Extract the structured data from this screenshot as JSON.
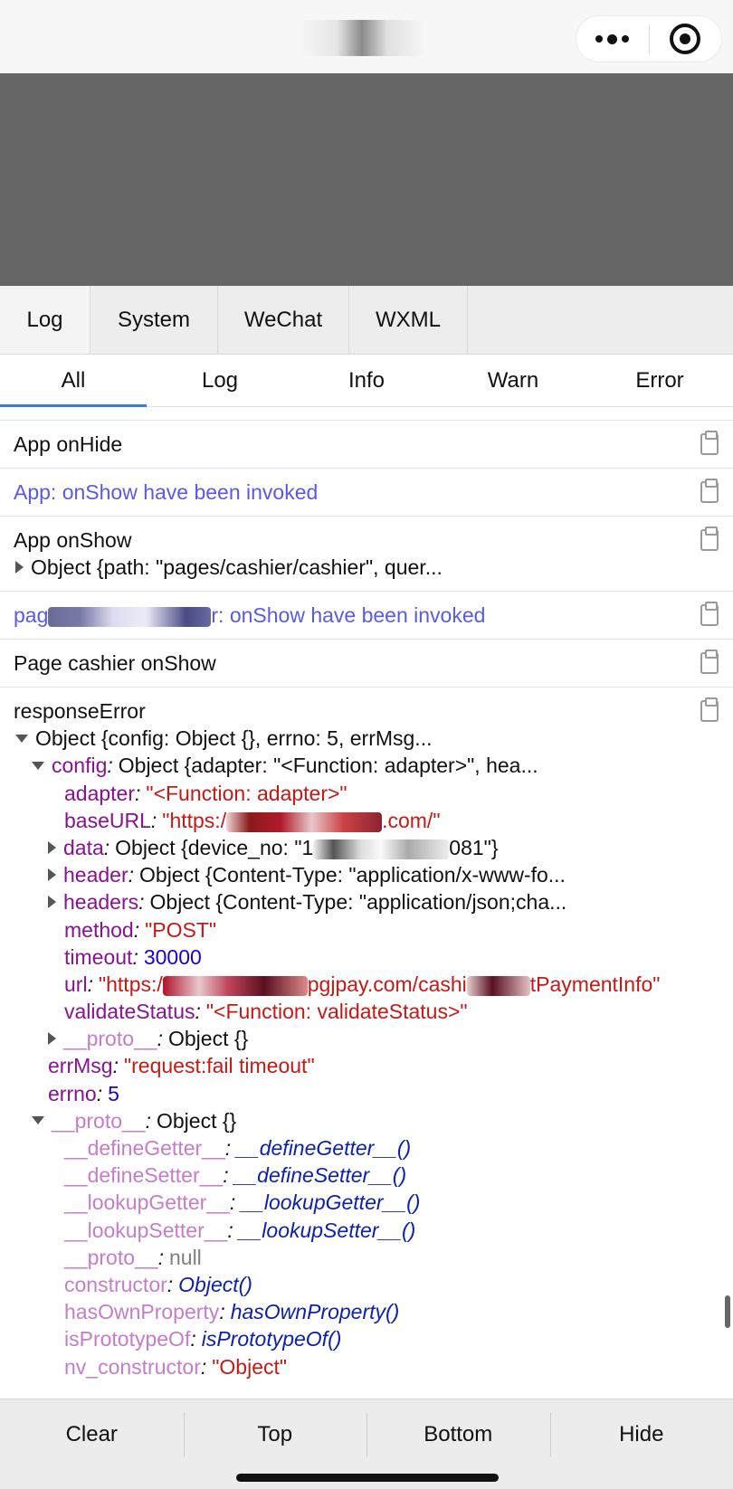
{
  "capsule": {
    "more_icon": "more-dots-icon",
    "close_icon": "record-target-icon"
  },
  "main_tabs": [
    "Log",
    "System",
    "WeChat",
    "WXML"
  ],
  "sub_tabs": [
    "All",
    "Log",
    "Info",
    "Warn",
    "Error"
  ],
  "logs": {
    "app_onhide": "App onHide",
    "app_onshow_invoked": "App: onShow have been invoked",
    "app_onshow": "App onShow",
    "app_onshow_obj": "Object {path: \"pages/cashier/cashier\", quer...",
    "page_invoked_prefix": "pag",
    "page_invoked_suffix": "r: onShow have been invoked",
    "page_cashier_onshow": "Page cashier onShow",
    "response_error": "responseError"
  },
  "tree": {
    "root": "Object {config: Object {}, errno: 5, errMsg...",
    "config_key": "config",
    "config_val": "Object {adapter: \"<Function: adapter>\", hea...",
    "adapter_key": "adapter",
    "adapter_val": "\"<Function: adapter>\"",
    "baseurl_key": "baseURL",
    "baseurl_prefix": "\"https:/",
    "baseurl_suffix": ".com/\"",
    "data_key": "data",
    "data_prefix": "Object {device_no: \"1",
    "data_suffix": "081\"}",
    "header_key": "header",
    "header_val": "Object {Content-Type: \"application/x-www-fo...",
    "headers_key": "headers",
    "headers_val": "Object {Content-Type: \"application/json;cha...",
    "method_key": "method",
    "method_val": "\"POST\"",
    "timeout_key": "timeout",
    "timeout_val": "30000",
    "url_key": "url",
    "url_prefix": "\"https:/",
    "url_mid": "pgjpay.com/cashi",
    "url_suffix": "tPaymentInfo\"",
    "validate_key": "validateStatus",
    "validate_val": "\"<Function: validateStatus>\"",
    "proto_key": "__proto__",
    "proto_val": "Object {}",
    "errmsg_key": "errMsg",
    "errmsg_val": "\"request:fail timeout\"",
    "errno_key": "errno",
    "errno_val": "5",
    "proto2_key": "__proto__",
    "proto2_val": "Object {}",
    "define_getter_key": "__defineGetter__",
    "define_getter_val": "__defineGetter__()",
    "define_setter_key": "__defineSetter__",
    "define_setter_val": "__defineSetter__()",
    "lookup_getter_key": "__lookupGetter__",
    "lookup_getter_val": "__lookupGetter__()",
    "lookup_setter_key": "__lookupSetter__",
    "lookup_setter_val": "__lookupSetter__()",
    "proto_null_key": "__proto__",
    "proto_null_val": "null",
    "constructor_key": "constructor",
    "constructor_val": "Object()",
    "hasown_key": "hasOwnProperty",
    "hasown_val": "hasOwnProperty()",
    "isproto_key": "isPrototypeOf",
    "isproto_val": "isPrototypeOf()",
    "nvcons_key": "nv_constructor",
    "nvcons_val": "\"Object\""
  },
  "toolbar": [
    "Clear",
    "Top",
    "Bottom",
    "Hide"
  ]
}
